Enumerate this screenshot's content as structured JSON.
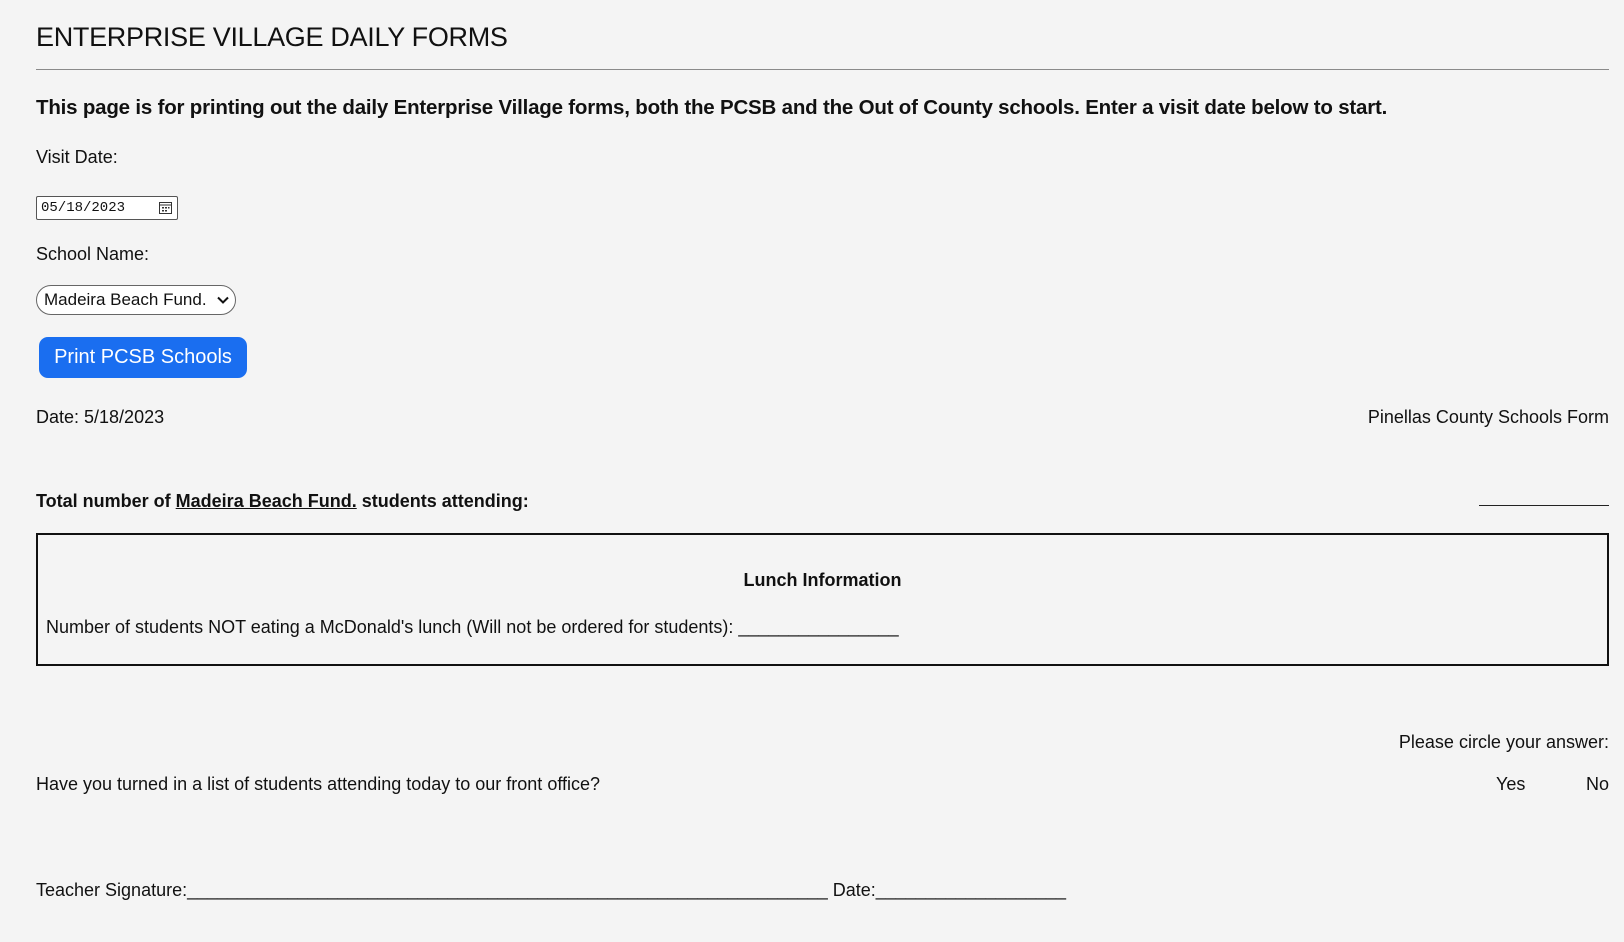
{
  "header": {
    "title": "ENTERPRISE VILLAGE DAILY FORMS",
    "intro": "This page is for printing out the daily Enterprise Village forms, both the PCSB and the Out of County schools. Enter a visit date below to start."
  },
  "controls": {
    "visit_date_label": "Visit Date:",
    "visit_date_value": "05/18/2023",
    "calendar_icon": "calendar-icon",
    "school_name_label": "School Name:",
    "school_selected": "Madeira Beach Fund.",
    "print_button_label": "Print PCSB Schools",
    "accent_color": "#1a6ef0"
  },
  "form": {
    "date_line": "Date: 5/18/2023",
    "form_name": "Pinellas County Schools Form",
    "total_prefix": "Total number of ",
    "total_school": "Madeira Beach Fund.",
    "total_suffix": " students attending:",
    "lunch_title": "Lunch Information",
    "lunch_question": "Number of students NOT eating a McDonald's lunch (Will not be ordered for students): ________________",
    "circle_instruction": "Please circle your answer:",
    "front_office_question": "Have you turned in a list of students attending today to our front office?",
    "yes_label": "Yes",
    "no_label": "No",
    "signature_line": "Teacher Signature:________________________________________________________________ Date:___________________"
  }
}
